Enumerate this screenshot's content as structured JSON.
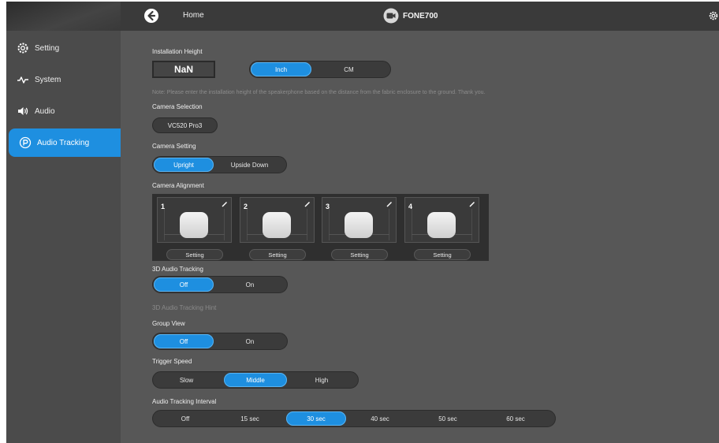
{
  "header": {
    "home_label": "Home",
    "device_name": "FONE700",
    "back_icon": "back-arrow-icon",
    "settings_icon": "gear-icon"
  },
  "sidebar": {
    "items": [
      {
        "label": "Setting",
        "icon": "gear-icon",
        "active": false
      },
      {
        "label": "System",
        "icon": "pulse-icon",
        "active": false
      },
      {
        "label": "Audio",
        "icon": "speaker-icon",
        "active": false
      },
      {
        "label": "Audio Tracking",
        "icon": "tracking-icon",
        "active": true
      }
    ]
  },
  "installation_height": {
    "label": "Installation Height",
    "value": "NaN",
    "units": [
      "Inch",
      "CM"
    ],
    "selected_unit": "Inch",
    "note": "Note: Please enter the installation height of the speakerphone based on the distance from the fabric enclosure to the ground. Thank you."
  },
  "camera_selection": {
    "label": "Camera Selection",
    "value": "VC520 Pro3"
  },
  "camera_setting": {
    "label": "Camera Setting",
    "options": [
      "Upright",
      "Upside Down"
    ],
    "selected": "Upright"
  },
  "camera_alignment": {
    "label": "Camera Alignment",
    "tiles": [
      {
        "number": "1",
        "button": "Setting"
      },
      {
        "number": "2",
        "button": "Setting"
      },
      {
        "number": "3",
        "button": "Setting"
      },
      {
        "number": "4",
        "button": "Setting"
      }
    ]
  },
  "audio_tracking_3d": {
    "label": "3D Audio Tracking",
    "options": [
      "Off",
      "On"
    ],
    "selected": "Off",
    "hint": "3D Audio Tracking Hint"
  },
  "group_view": {
    "label": "Group View",
    "options": [
      "Off",
      "On"
    ],
    "selected": "Off"
  },
  "trigger_speed": {
    "label": "Trigger Speed",
    "options": [
      "Slow",
      "Middle",
      "High"
    ],
    "selected": "Middle"
  },
  "tracking_interval": {
    "label": "Audio Tracking Interval",
    "options": [
      "Off",
      "15 sec",
      "30 sec",
      "40 sec",
      "50 sec",
      "60 sec"
    ],
    "selected": "30 sec"
  },
  "colors": {
    "accent": "#1e8fe0",
    "background": "#575757",
    "sidebar": "#4b4b4b",
    "topbar": "#3a3a3a"
  }
}
